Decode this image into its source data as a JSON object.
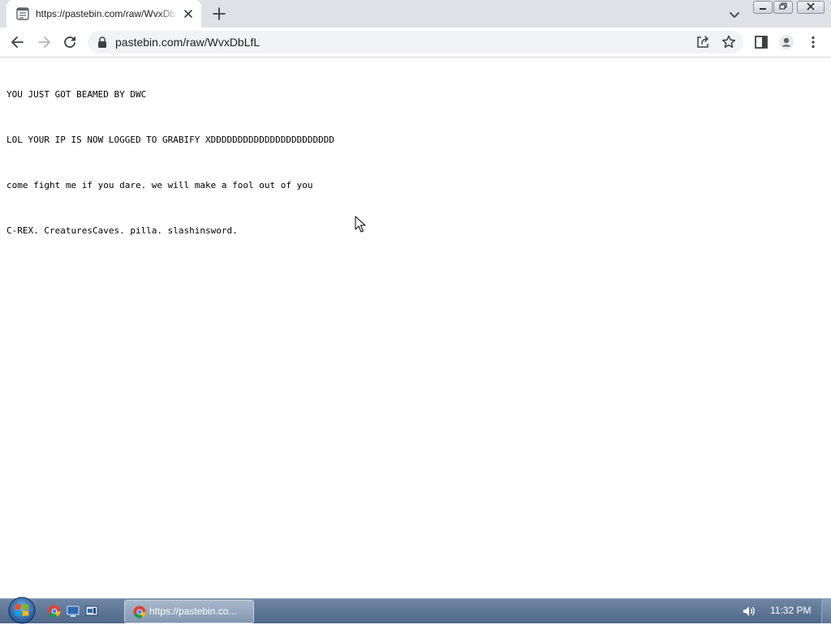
{
  "browser": {
    "tab": {
      "title": "https://pastebin.com/raw/WvxDbLfL"
    },
    "address_bar": {
      "url": "pastebin.com/raw/WvxDbLfL"
    }
  },
  "page": {
    "lines": [
      "YOU JUST GOT BEAMED BY DWC",
      "LOL YOUR IP IS NOW LOGGED TO GRABIFY XDDDDDDDDDDDDDDDDDDDDDDD",
      "come fight me if you dare. we will make a fool out of you",
      "C-REX. CreaturesCaves. pilla. slashinsword."
    ]
  },
  "taskbar": {
    "task_label": "https://pastebin.co...",
    "clock": "11:32 PM"
  },
  "colors": {
    "tabstrip_bg": "#dee1e6",
    "omnibox_bg": "#f1f3f4",
    "taskbar_bg": "#5a7194"
  },
  "icons": {
    "tab_favicon": "pastebin-favicon-icon",
    "back": "back-arrow-icon",
    "forward": "forward-arrow-icon",
    "reload": "reload-icon",
    "lock": "lock-icon",
    "share": "share-icon",
    "bookmark": "star-icon",
    "side_panel": "side-panel-icon",
    "profile": "profile-icon",
    "menu": "kebab-menu-icon"
  }
}
